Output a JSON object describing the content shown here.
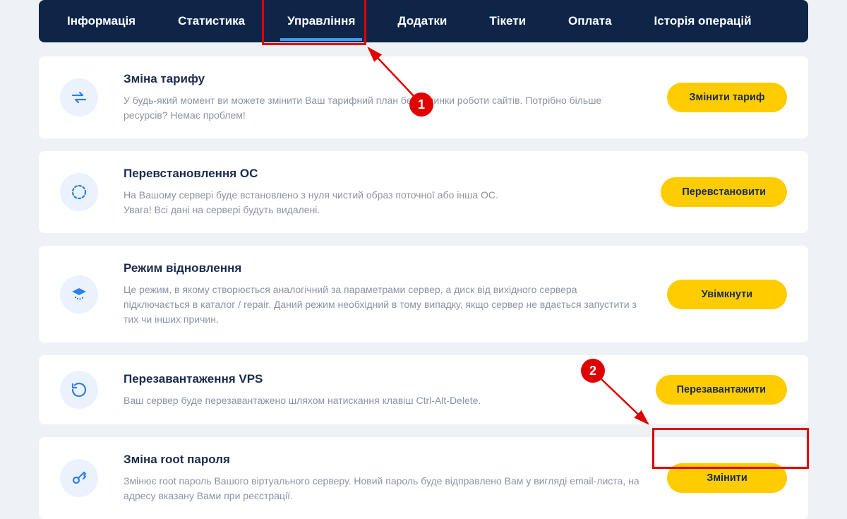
{
  "tabs": [
    {
      "label": "Інформація",
      "active": false
    },
    {
      "label": "Статистика",
      "active": false
    },
    {
      "label": "Управління",
      "active": true
    },
    {
      "label": "Додатки",
      "active": false
    },
    {
      "label": "Тікети",
      "active": false
    },
    {
      "label": "Оплата",
      "active": false
    },
    {
      "label": "Історія операцій",
      "active": false
    }
  ],
  "cards": [
    {
      "icon": "swap",
      "title": "Зміна тарифу",
      "desc": "У будь-який момент ви можете змінити Ваш тарифний план без зупинки роботи сайтів. Потрібно більше ресурсів? Немає проблем!",
      "button": "Змінити тариф"
    },
    {
      "icon": "reinstall",
      "title": "Перевстановлення ОС",
      "desc": "На Вашому сервері буде встановлено з нуля чистий образ поточної або інша ОС.\nУвага! Всі дані на сервері будуть видалені.",
      "button": "Перевстановити"
    },
    {
      "icon": "recovery",
      "title": "Режим відновлення",
      "desc": "Це режим, в якому створюється аналогічний за параметрами сервер, а диск від вихідного сервера підключається в каталог / repair. Даний режим необхідний в тому випадку, якщо сервер не вдається запустити з тих чи інших причин.",
      "button": "Увімкнути"
    },
    {
      "icon": "reboot",
      "title": "Перезавантаження VPS",
      "desc": "Ваш сервер буде перезавантажено шляхом натискання клавіш Ctrl-Alt-Delete.",
      "button": "Перезавантажити"
    },
    {
      "icon": "key",
      "title": "Зміна root пароля",
      "desc": "Змінює root пароль Вашого віртуального серверу. Новий пароль буде відправлено Вам у вигляді email-листа, на адресу вказану Вами при реєстрації.",
      "button": "Змінити"
    }
  ],
  "annotations": {
    "step1": "1",
    "step2": "2"
  }
}
